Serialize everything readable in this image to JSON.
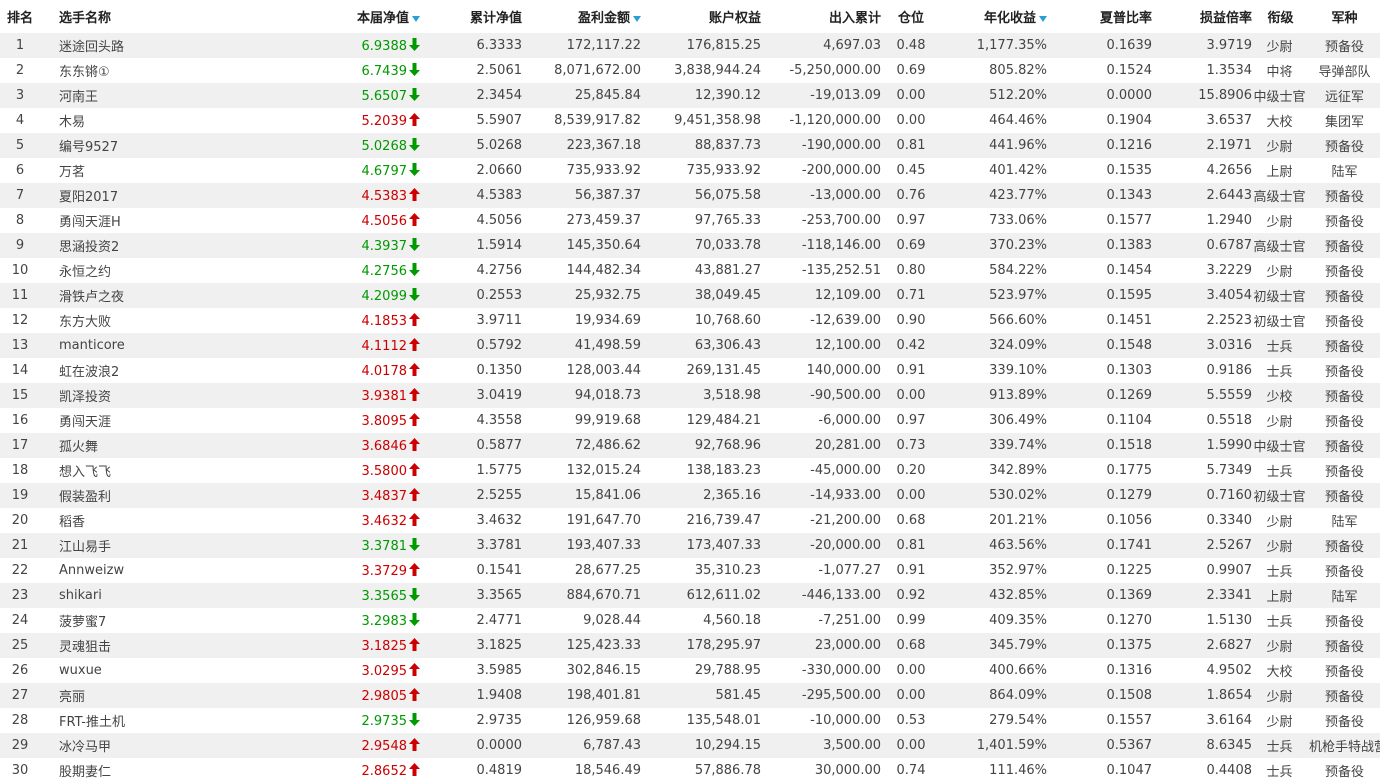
{
  "colors": {
    "up": "#cc0000",
    "down": "#009900",
    "sort_indicator": "#2a9fd6",
    "row_stripe": "#f0f0f0"
  },
  "headers": {
    "rank": "排名",
    "name": "选手名称",
    "nav": "本届净值",
    "cum_nav": "累计净值",
    "profit": "盈利金额",
    "equity": "账户权益",
    "flow": "出入累计",
    "position": "仓位",
    "annual": "年化收益",
    "sharpe": "夏普比率",
    "pl_ratio": "损益倍率",
    "grade": "衔级",
    "branch": "军种"
  },
  "sorted_columns_icon": "sort-descending-icon",
  "rows": [
    {
      "rank": "1",
      "name": "迷途回头路",
      "nav": "6.9388",
      "dir": "down",
      "cum_nav": "6.3333",
      "profit": "172,117.22",
      "equity": "176,815.25",
      "flow": "4,697.03",
      "position": "0.48",
      "annual": "1,177.35%",
      "sharpe": "0.1639",
      "pl_ratio": "3.9719",
      "grade": "少尉",
      "branch": "预备役"
    },
    {
      "rank": "2",
      "name": "东东锵①",
      "nav": "6.7439",
      "dir": "down",
      "cum_nav": "2.5061",
      "profit": "8,071,672.00",
      "equity": "3,838,944.24",
      "flow": "-5,250,000.00",
      "position": "0.69",
      "annual": "805.82%",
      "sharpe": "0.1524",
      "pl_ratio": "1.3534",
      "grade": "中将",
      "branch": "导弹部队"
    },
    {
      "rank": "3",
      "name": "河南王",
      "nav": "5.6507",
      "dir": "down",
      "cum_nav": "2.3454",
      "profit": "25,845.84",
      "equity": "12,390.12",
      "flow": "-19,013.09",
      "position": "0.00",
      "annual": "512.20%",
      "sharpe": "0.0000",
      "pl_ratio": "15.8906",
      "grade": "中级士官",
      "branch": "远征军"
    },
    {
      "rank": "4",
      "name": "木易",
      "nav": "5.2039",
      "dir": "up",
      "cum_nav": "5.5907",
      "profit": "8,539,917.82",
      "equity": "9,451,358.98",
      "flow": "-1,120,000.00",
      "position": "0.00",
      "annual": "464.46%",
      "sharpe": "0.1904",
      "pl_ratio": "3.6537",
      "grade": "大校",
      "branch": "集团军"
    },
    {
      "rank": "5",
      "name": "编号9527",
      "nav": "5.0268",
      "dir": "down",
      "cum_nav": "5.0268",
      "profit": "223,367.18",
      "equity": "88,837.73",
      "flow": "-190,000.00",
      "position": "0.81",
      "annual": "441.96%",
      "sharpe": "0.1216",
      "pl_ratio": "2.1971",
      "grade": "少尉",
      "branch": "预备役"
    },
    {
      "rank": "6",
      "name": "万茗",
      "nav": "4.6797",
      "dir": "down",
      "cum_nav": "2.0660",
      "profit": "735,933.92",
      "equity": "735,933.92",
      "flow": "-200,000.00",
      "position": "0.45",
      "annual": "401.42%",
      "sharpe": "0.1535",
      "pl_ratio": "4.2656",
      "grade": "上尉",
      "branch": "陆军"
    },
    {
      "rank": "7",
      "name": "夏阳2017",
      "nav": "4.5383",
      "dir": "up",
      "cum_nav": "4.5383",
      "profit": "56,387.37",
      "equity": "56,075.58",
      "flow": "-13,000.00",
      "position": "0.76",
      "annual": "423.77%",
      "sharpe": "0.1343",
      "pl_ratio": "2.6443",
      "grade": "高级士官",
      "branch": "预备役"
    },
    {
      "rank": "8",
      "name": "勇闯天涯H",
      "nav": "4.5056",
      "dir": "up",
      "cum_nav": "4.5056",
      "profit": "273,459.37",
      "equity": "97,765.33",
      "flow": "-253,700.00",
      "position": "0.97",
      "annual": "733.06%",
      "sharpe": "0.1577",
      "pl_ratio": "1.2940",
      "grade": "少尉",
      "branch": "预备役"
    },
    {
      "rank": "9",
      "name": "思涵投资2",
      "nav": "4.3937",
      "dir": "down",
      "cum_nav": "1.5914",
      "profit": "145,350.64",
      "equity": "70,033.78",
      "flow": "-118,146.00",
      "position": "0.69",
      "annual": "370.23%",
      "sharpe": "0.1383",
      "pl_ratio": "0.6787",
      "grade": "高级士官",
      "branch": "预备役"
    },
    {
      "rank": "10",
      "name": "永恒之约",
      "nav": "4.2756",
      "dir": "down",
      "cum_nav": "4.2756",
      "profit": "144,482.34",
      "equity": "43,881.27",
      "flow": "-135,252.51",
      "position": "0.80",
      "annual": "584.22%",
      "sharpe": "0.1454",
      "pl_ratio": "3.2229",
      "grade": "少尉",
      "branch": "预备役"
    },
    {
      "rank": "11",
      "name": "滑铁卢之夜",
      "nav": "4.2099",
      "dir": "down",
      "cum_nav": "0.2553",
      "profit": "25,932.75",
      "equity": "38,049.45",
      "flow": "12,109.00",
      "position": "0.71",
      "annual": "523.97%",
      "sharpe": "0.1595",
      "pl_ratio": "3.4054",
      "grade": "初级士官",
      "branch": "预备役"
    },
    {
      "rank": "12",
      "name": "东方大败",
      "nav": "4.1853",
      "dir": "up",
      "cum_nav": "3.9711",
      "profit": "19,934.69",
      "equity": "10,768.60",
      "flow": "-12,639.00",
      "position": "0.90",
      "annual": "566.60%",
      "sharpe": "0.1451",
      "pl_ratio": "2.2523",
      "grade": "初级士官",
      "branch": "预备役"
    },
    {
      "rank": "13",
      "name": "manticore",
      "nav": "4.1112",
      "dir": "up",
      "cum_nav": "0.5792",
      "profit": "41,498.59",
      "equity": "63,306.43",
      "flow": "12,100.00",
      "position": "0.42",
      "annual": "324.09%",
      "sharpe": "0.1548",
      "pl_ratio": "3.0316",
      "grade": "士兵",
      "branch": "预备役"
    },
    {
      "rank": "14",
      "name": "虹在波浪2",
      "nav": "4.0178",
      "dir": "up",
      "cum_nav": "0.1350",
      "profit": "128,003.44",
      "equity": "269,131.45",
      "flow": "140,000.00",
      "position": "0.91",
      "annual": "339.10%",
      "sharpe": "0.1303",
      "pl_ratio": "0.9186",
      "grade": "士兵",
      "branch": "预备役"
    },
    {
      "rank": "15",
      "name": "凯泽投资",
      "nav": "3.9381",
      "dir": "up",
      "cum_nav": "3.0419",
      "profit": "94,018.73",
      "equity": "3,518.98",
      "flow": "-90,500.00",
      "position": "0.00",
      "annual": "913.89%",
      "sharpe": "0.1269",
      "pl_ratio": "5.5559",
      "grade": "少校",
      "branch": "预备役"
    },
    {
      "rank": "16",
      "name": "勇闯天涯",
      "nav": "3.8095",
      "dir": "up",
      "cum_nav": "4.3558",
      "profit": "99,919.68",
      "equity": "129,484.21",
      "flow": "-6,000.00",
      "position": "0.97",
      "annual": "306.49%",
      "sharpe": "0.1104",
      "pl_ratio": "0.5518",
      "grade": "少尉",
      "branch": "预备役"
    },
    {
      "rank": "17",
      "name": "孤火舞",
      "nav": "3.6846",
      "dir": "up",
      "cum_nav": "0.5877",
      "profit": "72,486.62",
      "equity": "92,768.96",
      "flow": "20,281.00",
      "position": "0.73",
      "annual": "339.74%",
      "sharpe": "0.1518",
      "pl_ratio": "1.5990",
      "grade": "中级士官",
      "branch": "预备役"
    },
    {
      "rank": "18",
      "name": "想入飞飞",
      "nav": "3.5800",
      "dir": "up",
      "cum_nav": "1.5775",
      "profit": "132,015.24",
      "equity": "138,183.23",
      "flow": "-45,000.00",
      "position": "0.20",
      "annual": "342.89%",
      "sharpe": "0.1775",
      "pl_ratio": "5.7349",
      "grade": "士兵",
      "branch": "预备役"
    },
    {
      "rank": "19",
      "name": "假装盈利",
      "nav": "3.4837",
      "dir": "up",
      "cum_nav": "2.5255",
      "profit": "15,841.06",
      "equity": "2,365.16",
      "flow": "-14,933.00",
      "position": "0.00",
      "annual": "530.02%",
      "sharpe": "0.1279",
      "pl_ratio": "0.7160",
      "grade": "初级士官",
      "branch": "预备役"
    },
    {
      "rank": "20",
      "name": "稻香",
      "nav": "3.4632",
      "dir": "up",
      "cum_nav": "3.4632",
      "profit": "191,647.70",
      "equity": "216,739.47",
      "flow": "-21,200.00",
      "position": "0.68",
      "annual": "201.21%",
      "sharpe": "0.1056",
      "pl_ratio": "0.3340",
      "grade": "少尉",
      "branch": "陆军"
    },
    {
      "rank": "21",
      "name": "江山易手",
      "nav": "3.3781",
      "dir": "down",
      "cum_nav": "3.3781",
      "profit": "193,407.33",
      "equity": "173,407.33",
      "flow": "-20,000.00",
      "position": "0.81",
      "annual": "463.56%",
      "sharpe": "0.1741",
      "pl_ratio": "2.5267",
      "grade": "少尉",
      "branch": "预备役"
    },
    {
      "rank": "22",
      "name": "Annweizw",
      "nav": "3.3729",
      "dir": "up",
      "cum_nav": "0.1541",
      "profit": "28,677.25",
      "equity": "35,310.23",
      "flow": "-1,077.27",
      "position": "0.91",
      "annual": "352.97%",
      "sharpe": "0.1225",
      "pl_ratio": "0.9907",
      "grade": "士兵",
      "branch": "预备役"
    },
    {
      "rank": "23",
      "name": "shikari",
      "nav": "3.3565",
      "dir": "down",
      "cum_nav": "3.3565",
      "profit": "884,670.71",
      "equity": "612,611.02",
      "flow": "-446,133.00",
      "position": "0.92",
      "annual": "432.85%",
      "sharpe": "0.1369",
      "pl_ratio": "2.3341",
      "grade": "上尉",
      "branch": "陆军"
    },
    {
      "rank": "24",
      "name": "菠萝蜜7",
      "nav": "3.2983",
      "dir": "down",
      "cum_nav": "2.4771",
      "profit": "9,028.44",
      "equity": "4,560.18",
      "flow": "-7,251.00",
      "position": "0.99",
      "annual": "409.35%",
      "sharpe": "0.1270",
      "pl_ratio": "1.5130",
      "grade": "士兵",
      "branch": "预备役"
    },
    {
      "rank": "25",
      "name": "灵魂狙击",
      "nav": "3.1825",
      "dir": "up",
      "cum_nav": "3.1825",
      "profit": "125,423.33",
      "equity": "178,295.97",
      "flow": "23,000.00",
      "position": "0.68",
      "annual": "345.79%",
      "sharpe": "0.1375",
      "pl_ratio": "2.6827",
      "grade": "少尉",
      "branch": "预备役"
    },
    {
      "rank": "26",
      "name": "wuxue",
      "nav": "3.0295",
      "dir": "up",
      "cum_nav": "3.5985",
      "profit": "302,846.15",
      "equity": "29,788.95",
      "flow": "-330,000.00",
      "position": "0.00",
      "annual": "400.66%",
      "sharpe": "0.1316",
      "pl_ratio": "4.9502",
      "grade": "大校",
      "branch": "预备役"
    },
    {
      "rank": "27",
      "name": "亮丽",
      "nav": "2.9805",
      "dir": "up",
      "cum_nav": "1.9408",
      "profit": "198,401.81",
      "equity": "581.45",
      "flow": "-295,500.00",
      "position": "0.00",
      "annual": "864.09%",
      "sharpe": "0.1508",
      "pl_ratio": "1.8654",
      "grade": "少尉",
      "branch": "预备役"
    },
    {
      "rank": "28",
      "name": "FRT-推土机",
      "nav": "2.9735",
      "dir": "down",
      "cum_nav": "2.9735",
      "profit": "126,959.68",
      "equity": "135,548.01",
      "flow": "-10,000.00",
      "position": "0.53",
      "annual": "279.54%",
      "sharpe": "0.1557",
      "pl_ratio": "3.6164",
      "grade": "少尉",
      "branch": "预备役"
    },
    {
      "rank": "29",
      "name": "冰冷马甲",
      "nav": "2.9548",
      "dir": "up",
      "cum_nav": "0.0000",
      "profit": "6,787.43",
      "equity": "10,294.15",
      "flow": "3,500.00",
      "position": "0.00",
      "annual": "1,401.59%",
      "sharpe": "0.5367",
      "pl_ratio": "8.6345",
      "grade": "士兵",
      "branch": "机枪手特战营"
    },
    {
      "rank": "30",
      "name": "股期妻仁",
      "nav": "2.8652",
      "dir": "up",
      "cum_nav": "0.4819",
      "profit": "18,546.49",
      "equity": "57,886.78",
      "flow": "30,000.00",
      "position": "0.74",
      "annual": "111.46%",
      "sharpe": "0.1047",
      "pl_ratio": "0.4408",
      "grade": "士兵",
      "branch": "预备役"
    }
  ]
}
